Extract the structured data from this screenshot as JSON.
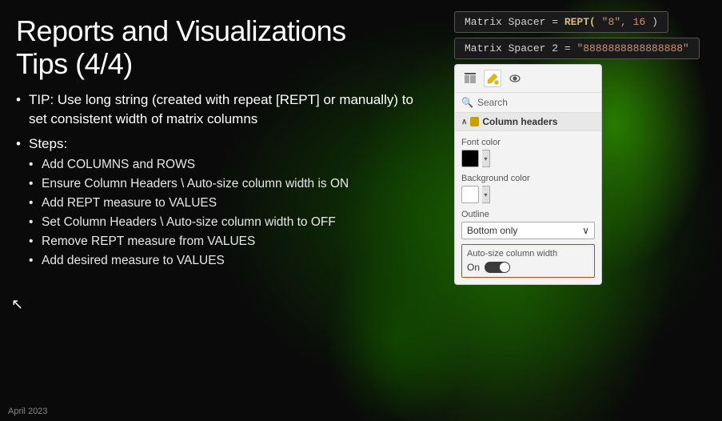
{
  "title": {
    "line1": "Reports and Visualizations",
    "line2": "Tips (4/4)"
  },
  "bullets": [
    {
      "text": "TIP: Use long string (created with repeat [REPT] or manually) to set consistent width of matrix columns",
      "sub": []
    },
    {
      "text": "Steps:",
      "sub": [
        "Add COLUMNS and ROWS",
        "Ensure Column Headers \\ Auto-size column width is ON",
        "Add REPT measure to VALUES",
        "Set Column Headers \\ Auto-size column width to OFF",
        "Remove REPT measure from VALUES",
        "Add desired measure to VALUES"
      ]
    }
  ],
  "formula1": {
    "label": "Matrix Spacer = ",
    "func": "REPT(",
    "arg1": "\"8\", 16",
    "close": ")"
  },
  "formula2": {
    "label": "Matrix Spacer 2 = ",
    "value": "\"8888888888888888\""
  },
  "panel": {
    "toolbar_icons": [
      "table-icon",
      "paint-icon",
      "eye-icon"
    ],
    "search_placeholder": "Search",
    "section_label": "Column headers",
    "font_color_label": "Font color",
    "bg_color_label": "Background color",
    "outline_label": "Outline",
    "outline_value": "Bottom only",
    "autosize_label": "Auto-size column width",
    "toggle_label": "On"
  },
  "slide_number": "April 2023",
  "cursor": "↖"
}
